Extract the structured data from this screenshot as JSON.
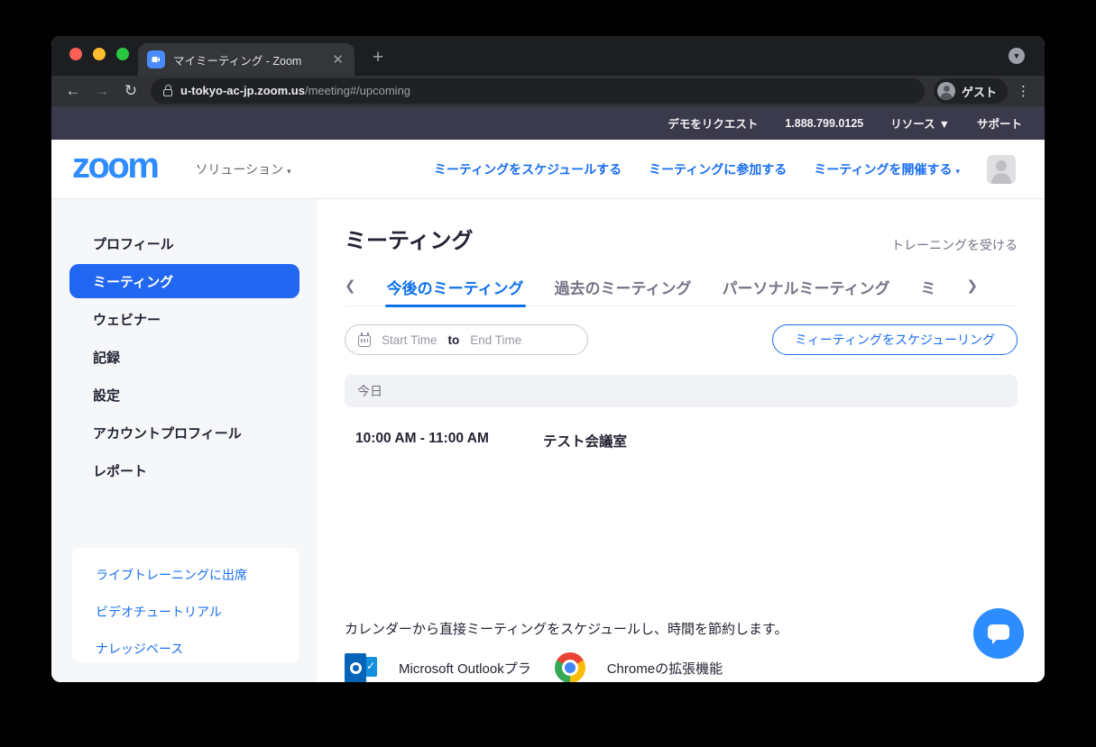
{
  "colors": {
    "accent_blue": "#1a6ef0",
    "logo_blue": "#2D8CFF",
    "active_tab_blue": "#0E72ED",
    "topnav_navy": "#3b3a4d",
    "sidebar_active": "#2267f2"
  },
  "browser": {
    "tab_title": "マイミーティング - Zoom",
    "url_host": "u-tokyo-ac-jp.zoom.us",
    "url_path": "/meeting#/upcoming",
    "guest_label": "ゲスト"
  },
  "topnav": {
    "request_demo": "デモをリクエスト",
    "phone": "1.888.799.0125",
    "resources": "リソース",
    "support": "サポート"
  },
  "header": {
    "logo_text": "zoom",
    "solutions": "ソリューション",
    "schedule_link": "ミーティングをスケジュールする",
    "join_link": "ミーティングに参加する",
    "host_link": "ミーティングを開催する"
  },
  "sidebar": {
    "items": [
      {
        "label": "プロフィール",
        "active": false
      },
      {
        "label": "ミーティング",
        "active": true
      },
      {
        "label": "ウェビナー",
        "active": false
      },
      {
        "label": "記録",
        "active": false
      },
      {
        "label": "設定",
        "active": false
      },
      {
        "label": "アカウントプロフィール",
        "active": false
      },
      {
        "label": "レポート",
        "active": false
      }
    ],
    "footer_links": [
      {
        "label": "ライブトレーニングに出席"
      },
      {
        "label": "ビデオチュートリアル"
      },
      {
        "label": "ナレッジベース"
      }
    ]
  },
  "main": {
    "title": "ミーティング",
    "training_link": "トレーニングを受ける",
    "tabs": [
      {
        "label": "今後のミーティング",
        "active": true
      },
      {
        "label": "過去のミーティング",
        "active": false
      },
      {
        "label": "パーソナルミーティング",
        "active": false
      },
      {
        "label": "ミ",
        "active": false
      }
    ],
    "filter": {
      "start_placeholder": "Start Time",
      "to_label": "to",
      "end_placeholder": "End Time"
    },
    "schedule_button": "ミィーティングをスケジューリング",
    "today_label": "今日",
    "meetings": [
      {
        "time": "10:00 AM - 11:00 AM",
        "name": "テスト会議室"
      }
    ],
    "calendar_hint": "カレンダーから直接ミーティングをスケジュールし、時間を節約します。",
    "integrations": [
      {
        "label": "Microsoft Outlookプラ"
      },
      {
        "label": "Chromeの拡張機能"
      }
    ]
  }
}
